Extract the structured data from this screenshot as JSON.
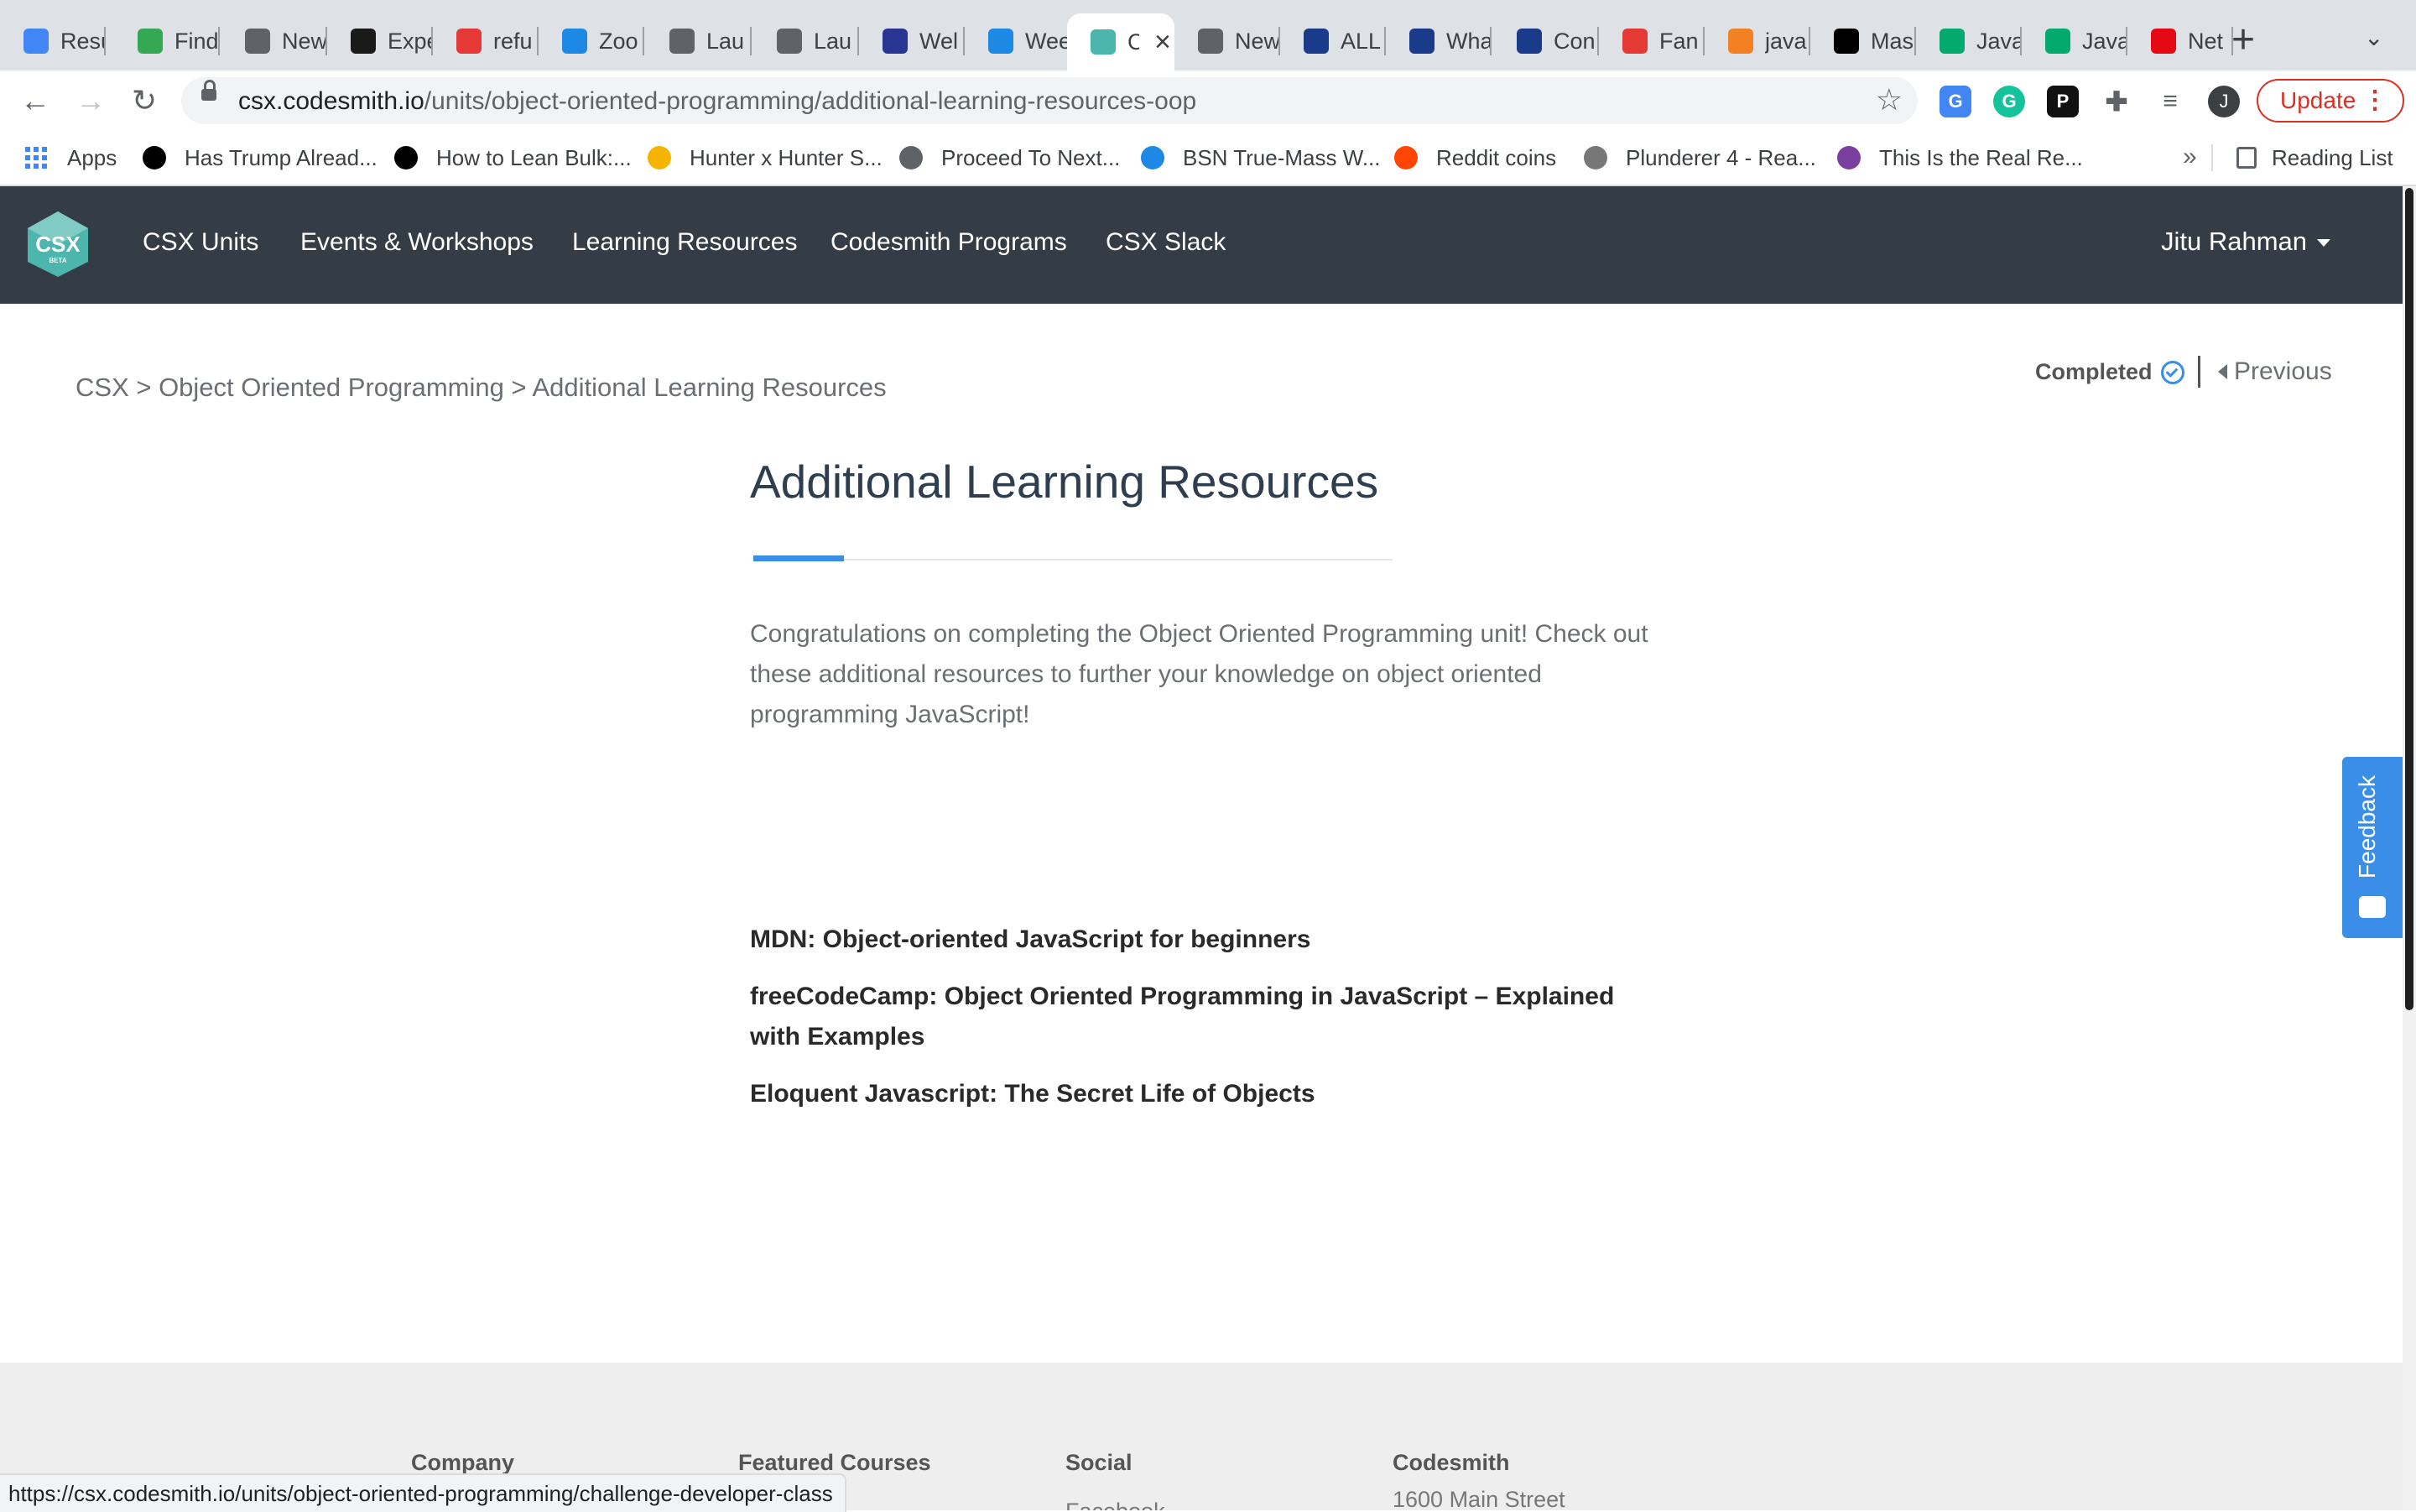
{
  "browser": {
    "tabs": [
      {
        "label": "Resu",
        "icon": "docs-icon",
        "color": "#4285f4"
      },
      {
        "label": "Find",
        "icon": "glasses-icon",
        "color": "#34a853"
      },
      {
        "label": "New",
        "icon": "chrome-icon",
        "color": "#5f6368"
      },
      {
        "label": "Expe",
        "icon": "plane-icon",
        "color": "#1a1a1a"
      },
      {
        "label": "refu",
        "icon": "tp-icon",
        "color": "#e53935"
      },
      {
        "label": "Zoo",
        "icon": "cap-icon",
        "color": "#1e88e5"
      },
      {
        "label": "Lau",
        "icon": "globe-icon",
        "color": "#5f6368"
      },
      {
        "label": "Lau",
        "icon": "globe-icon",
        "color": "#5f6368"
      },
      {
        "label": "Wel",
        "icon": "chart-icon",
        "color": "#283593"
      },
      {
        "label": "Wee",
        "icon": "cap-icon",
        "color": "#1e88e5"
      },
      {
        "label": "C",
        "icon": "csx-icon",
        "color": "#4db6ac",
        "active": true
      },
      {
        "label": "New",
        "icon": "chrome-icon",
        "color": "#5f6368"
      },
      {
        "label": "ALL",
        "icon": "seventeen-icon",
        "color": "#1a3a8a"
      },
      {
        "label": "Wha",
        "icon": "seventeen-icon",
        "color": "#1a3a8a"
      },
      {
        "label": "Con",
        "icon": "seventeen-icon",
        "color": "#1a3a8a"
      },
      {
        "label": "Fan",
        "icon": "checker-icon",
        "color": "#e53935"
      },
      {
        "label": "java",
        "icon": "stack-icon",
        "color": "#f48024"
      },
      {
        "label": "Mas",
        "icon": "dev-icon",
        "color": "#000000"
      },
      {
        "label": "Java",
        "icon": "w3-icon",
        "color": "#04aa6d"
      },
      {
        "label": "Java",
        "icon": "w3-icon",
        "color": "#04aa6d"
      },
      {
        "label": "Net",
        "icon": "netflix-icon",
        "color": "#e50914"
      }
    ],
    "url_host": "csx.codesmith.io",
    "url_path": "/units/object-oriented-programming/additional-learning-resources-oop",
    "update_label": "Update",
    "profile_initial": "J",
    "bookmarks": [
      {
        "label": "Apps"
      },
      {
        "label": "Has Trump Alread...",
        "icon": "h-icon",
        "color": "#000000"
      },
      {
        "label": "How to Lean Bulk:...",
        "icon": "g-icon",
        "color": "#000000"
      },
      {
        "label": "Hunter x Hunter S...",
        "icon": "hex-icon",
        "color": "#f4b400"
      },
      {
        "label": "Proceed To Next...",
        "icon": "globe-icon",
        "color": "#5f6368"
      },
      {
        "label": "BSN True-Mass W...",
        "icon": "b-icon",
        "color": "#1e88e5"
      },
      {
        "label": "Reddit coins",
        "icon": "reddit-icon",
        "color": "#ff4500"
      },
      {
        "label": "Plunderer 4 - Rea...",
        "icon": "figure-icon",
        "color": "#777777"
      },
      {
        "label": "This Is the Real Re...",
        "icon": "s-icon",
        "color": "#7b3fa0"
      }
    ],
    "reading_list": "Reading List",
    "status_url": "https://csx.codesmith.io/units/object-oriented-programming/challenge-developer-class"
  },
  "nav": {
    "logo_text": "CSX",
    "logo_sub": "BETA",
    "links": [
      "CSX Units",
      "Events & Workshops",
      "Learning Resources",
      "Codesmith Programs",
      "CSX Slack"
    ],
    "user": "Jitu Rahman"
  },
  "breadcrumb": "CSX > Object Oriented Programming > Additional Learning Resources",
  "status": {
    "completed": "Completed",
    "previous": "Previous"
  },
  "content": {
    "title": "Additional Learning Resources",
    "intro": "Congratulations on completing the Object Oriented Programming unit! Check out these additional resources to further your knowledge on object oriented programming JavaScript!",
    "resources": [
      "MDN: Object-oriented JavaScript for beginners",
      "freeCodeCamp: Object Oriented Programming in JavaScript – Explained with Examples",
      "Eloquent Javascript: The Secret Life of Objects"
    ]
  },
  "feedback_label": "Feedback",
  "footer": {
    "columns": [
      "Company",
      "Featured Courses",
      "Social",
      "Codesmith"
    ],
    "social_first": "Facebook",
    "address": "1600 Main Street"
  },
  "colors": {
    "nav_bg": "#343d46",
    "accent": "#3b8ee8",
    "title": "#2e3e4f",
    "update_red": "#d93025"
  }
}
